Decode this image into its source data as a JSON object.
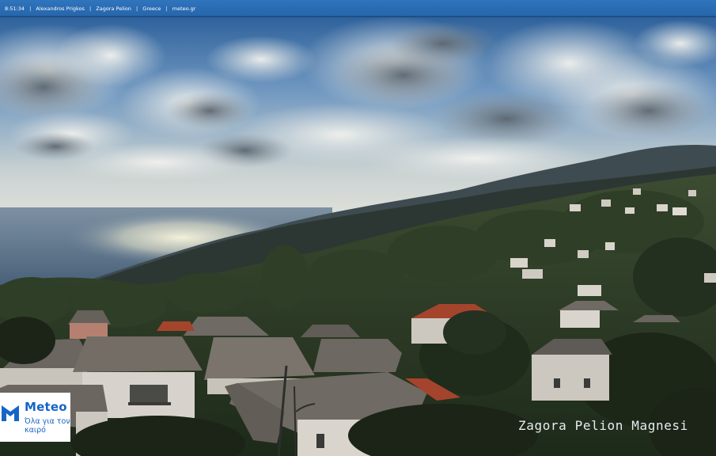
{
  "header": {
    "time": "8:51:34",
    "photographer": "Alexandros Prigkos",
    "location": "Zagora Pelion",
    "country": "Greece",
    "site": "meteo.gr",
    "separator": "|"
  },
  "logo": {
    "brand": "Meteo",
    "tagline": "Όλα για τον καιρό",
    "color": "#1565c7"
  },
  "caption": "Zagora Pelion Magnesi",
  "palette": {
    "sky_top": "#3a6fa8",
    "sky_horizon": "#d9dcd6",
    "sea": "#4e6b88",
    "sun_glare": "#f3f0d8",
    "mountains": "#2c3a3d",
    "forest": "#253322",
    "roof_slate": "#6f6a63",
    "roof_tile": "#a5442c",
    "wall": "#d7d3cc"
  }
}
